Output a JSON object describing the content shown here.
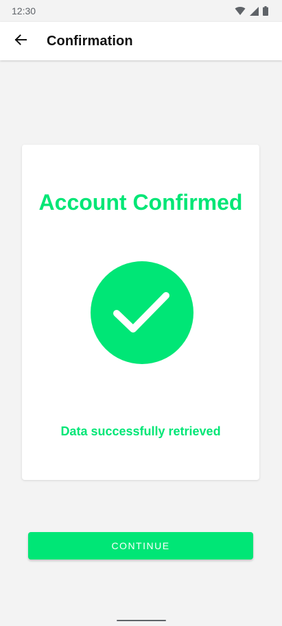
{
  "status_bar": {
    "time": "12:30",
    "icons": [
      "wifi-icon",
      "signal-icon",
      "battery-icon"
    ]
  },
  "app_bar": {
    "back_icon": "arrow-left-icon",
    "title": "Confirmation"
  },
  "card": {
    "title": "Account Confirmed",
    "icon": "check-circle-icon",
    "subtitle": "Data successfully retrieved"
  },
  "actions": {
    "continue_label": "CONTINUE"
  },
  "colors": {
    "accent": "#00e676",
    "background": "#f3f3f3",
    "surface": "#ffffff"
  }
}
